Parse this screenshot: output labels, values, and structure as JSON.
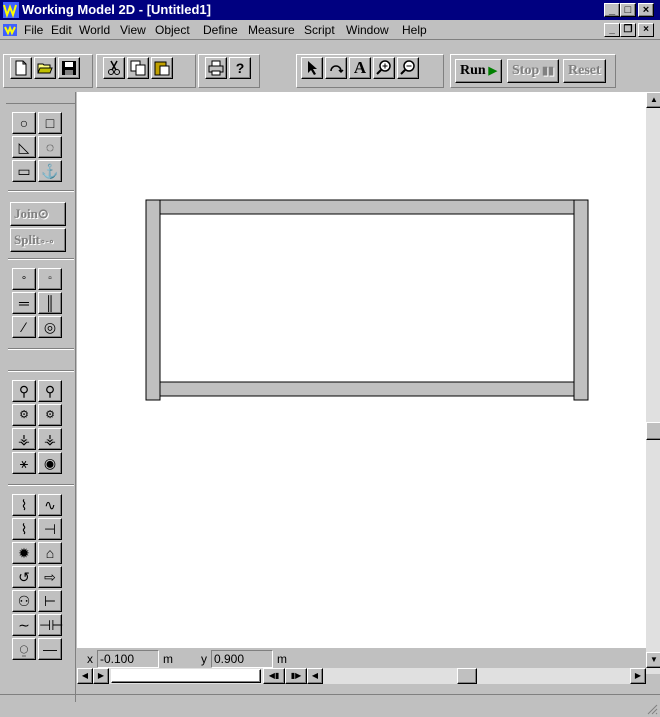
{
  "window": {
    "title": "Working Model 2D - [Untitled1]",
    "buttons": {
      "minimize": "_",
      "maximize": "□",
      "close": "×"
    }
  },
  "menubar": {
    "items": [
      "File",
      "Edit",
      "World",
      "View",
      "Object",
      "Define",
      "Measure",
      "Script",
      "Window",
      "Help"
    ],
    "doc_buttons": {
      "minimize": "_",
      "restore": "❐",
      "close": "×"
    }
  },
  "toolbar": {
    "run_label": "Run",
    "stop_label": "Stop",
    "reset_label": "Reset",
    "text_tool": "A",
    "help_tool": "?"
  },
  "palette": {
    "join_label": "Join",
    "split_label": "Split"
  },
  "coords": {
    "x_label": "x",
    "x_value": "-0.100",
    "x_unit": "m",
    "y_label": "y",
    "y_value": "0.900",
    "y_unit": "m"
  },
  "colors": {
    "titlebar": "#000080",
    "run_arrow": "#008000"
  }
}
